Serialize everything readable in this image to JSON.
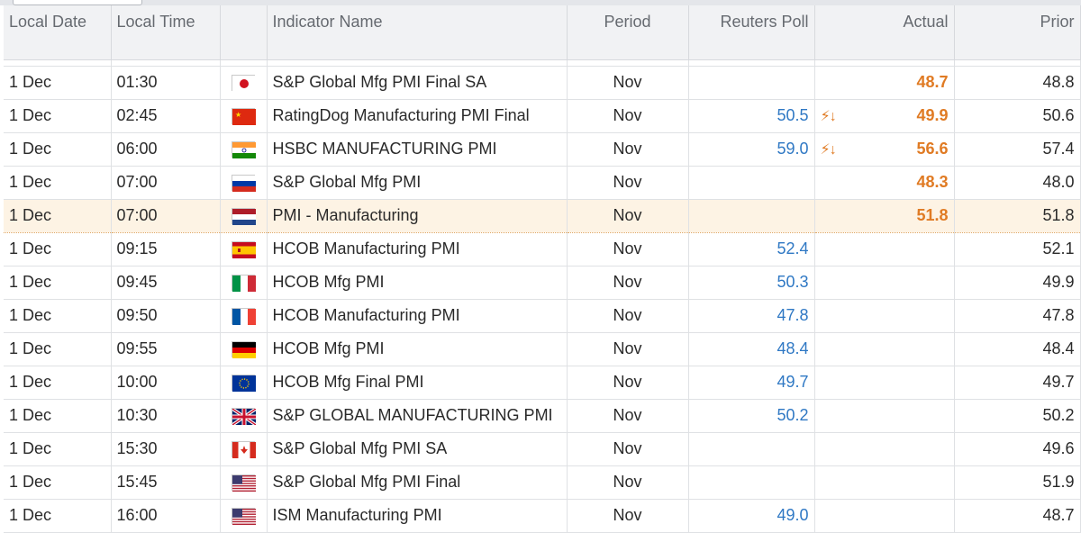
{
  "columns": {
    "date": "Local Date",
    "time": "Local Time",
    "indicator": "Indicator Name",
    "period": "Period",
    "poll": "Reuters Poll",
    "actual": "Actual",
    "prior": "Prior"
  },
  "colors": {
    "poll": "#2f78c4",
    "actual": "#e07b24",
    "highlight_row": "#fdf3e4",
    "header_bg": "#f1f2f4"
  },
  "rows": [
    {
      "date": "1 Dec",
      "time": "01:30",
      "flag": "japan-flag-icon",
      "indicator": "S&P Global Mfg PMI Final SA",
      "period": "Nov",
      "poll": "",
      "surprise": "",
      "actual": "48.7",
      "prior": "48.8"
    },
    {
      "date": "1 Dec",
      "time": "02:45",
      "flag": "china-flag-icon",
      "indicator": "RatingDog Manufacturing PMI Final",
      "period": "Nov",
      "poll": "50.5",
      "surprise": "⚡↓",
      "actual": "49.9",
      "prior": "50.6"
    },
    {
      "date": "1 Dec",
      "time": "06:00",
      "flag": "india-flag-icon",
      "indicator": "HSBC MANUFACTURING PMI",
      "period": "Nov",
      "poll": "59.0",
      "surprise": "⚡↓",
      "actual": "56.6",
      "prior": "57.4"
    },
    {
      "date": "1 Dec",
      "time": "07:00",
      "flag": "russia-flag-icon",
      "indicator": "S&P Global Mfg PMI",
      "period": "Nov",
      "poll": "",
      "surprise": "",
      "actual": "48.3",
      "prior": "48.0"
    },
    {
      "date": "1 Dec",
      "time": "07:00",
      "flag": "netherlands-flag-icon",
      "indicator": "PMI - Manufacturing",
      "period": "Nov",
      "poll": "",
      "surprise": "",
      "actual": "51.8",
      "prior": "51.8",
      "highlight": true
    },
    {
      "date": "1 Dec",
      "time": "09:15",
      "flag": "spain-flag-icon",
      "indicator": "HCOB Manufacturing PMI",
      "period": "Nov",
      "poll": "52.4",
      "surprise": "",
      "actual": "",
      "prior": "52.1"
    },
    {
      "date": "1 Dec",
      "time": "09:45",
      "flag": "italy-flag-icon",
      "indicator": "HCOB Mfg PMI",
      "period": "Nov",
      "poll": "50.3",
      "surprise": "",
      "actual": "",
      "prior": "49.9"
    },
    {
      "date": "1 Dec",
      "time": "09:50",
      "flag": "france-flag-icon",
      "indicator": "HCOB Manufacturing PMI",
      "period": "Nov",
      "poll": "47.8",
      "surprise": "",
      "actual": "",
      "prior": "47.8"
    },
    {
      "date": "1 Dec",
      "time": "09:55",
      "flag": "germany-flag-icon",
      "indicator": "HCOB Mfg PMI",
      "period": "Nov",
      "poll": "48.4",
      "surprise": "",
      "actual": "",
      "prior": "48.4"
    },
    {
      "date": "1 Dec",
      "time": "10:00",
      "flag": "eu-flag-icon",
      "indicator": "HCOB Mfg Final PMI",
      "period": "Nov",
      "poll": "49.7",
      "surprise": "",
      "actual": "",
      "prior": "49.7"
    },
    {
      "date": "1 Dec",
      "time": "10:30",
      "flag": "uk-flag-icon",
      "indicator": "S&P GLOBAL MANUFACTURING PMI",
      "period": "Nov",
      "poll": "50.2",
      "surprise": "",
      "actual": "",
      "prior": "50.2"
    },
    {
      "date": "1 Dec",
      "time": "15:30",
      "flag": "canada-flag-icon",
      "indicator": "S&P Global Mfg PMI SA",
      "period": "Nov",
      "poll": "",
      "surprise": "",
      "actual": "",
      "prior": "49.6"
    },
    {
      "date": "1 Dec",
      "time": "15:45",
      "flag": "usa-flag-icon",
      "indicator": "S&P Global Mfg PMI Final",
      "period": "Nov",
      "poll": "",
      "surprise": "",
      "actual": "",
      "prior": "51.9"
    },
    {
      "date": "1 Dec",
      "time": "16:00",
      "flag": "usa-flag-icon",
      "indicator": "ISM Manufacturing PMI",
      "period": "Nov",
      "poll": "49.0",
      "surprise": "",
      "actual": "",
      "prior": "48.7"
    }
  ]
}
